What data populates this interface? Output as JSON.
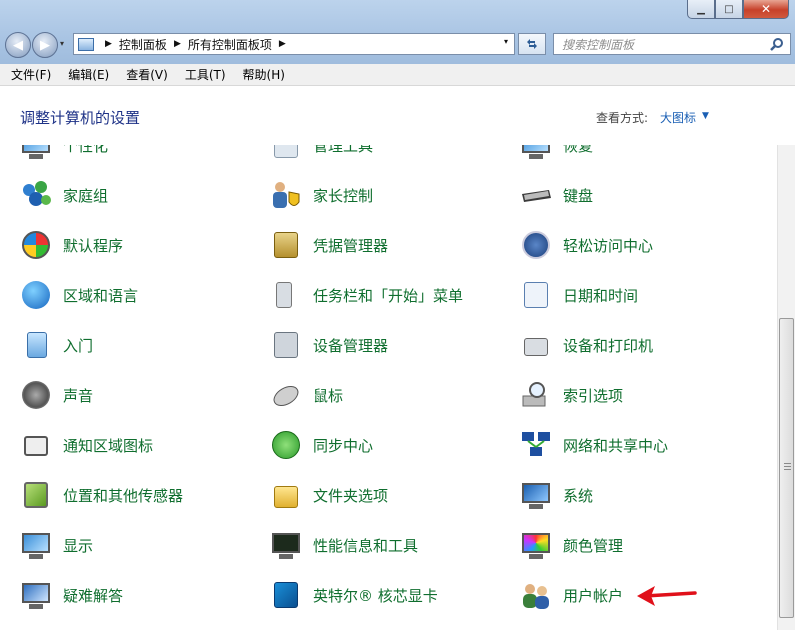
{
  "window": {
    "minimize_glyph": "▁",
    "maximize_glyph": "□",
    "close_glyph": "✕"
  },
  "nav": {
    "back_glyph": "◀",
    "forward_glyph": "▶",
    "dropdown_glyph": "▾"
  },
  "address": {
    "crumbs": [
      "控制面板",
      "所有控制面板项"
    ],
    "sep_glyph": "▶",
    "dropdown_glyph": "▾"
  },
  "search": {
    "placeholder": "搜索控制面板",
    "icon": "search-icon"
  },
  "menu": {
    "items": [
      "文件(F)",
      "编辑(E)",
      "查看(V)",
      "工具(T)",
      "帮助(H)"
    ]
  },
  "header": {
    "title": "调整计算机的设置",
    "view_label": "查看方式:",
    "view_value": "大图标",
    "view_arrow": "▼"
  },
  "items": [
    [
      "个性化",
      "管理工具",
      "恢复"
    ],
    [
      "家庭组",
      "家长控制",
      "键盘"
    ],
    [
      "默认程序",
      "凭据管理器",
      "轻松访问中心"
    ],
    [
      "区域和语言",
      "任务栏和「开始」菜单",
      "日期和时间"
    ],
    [
      "入门",
      "设备管理器",
      "设备和打印机"
    ],
    [
      "声音",
      "鼠标",
      "索引选项"
    ],
    [
      "通知区域图标",
      "同步中心",
      "网络和共享中心"
    ],
    [
      "位置和其他传感器",
      "文件夹选项",
      "系统"
    ],
    [
      "显示",
      "性能信息和工具",
      "颜色管理"
    ],
    [
      "疑难解答",
      "英特尔® 核芯显卡",
      "用户帐户"
    ]
  ],
  "colors": {
    "link_green": "#0f6e2e",
    "title_blue": "#1e3287",
    "arrow_red": "#e0101a"
  }
}
